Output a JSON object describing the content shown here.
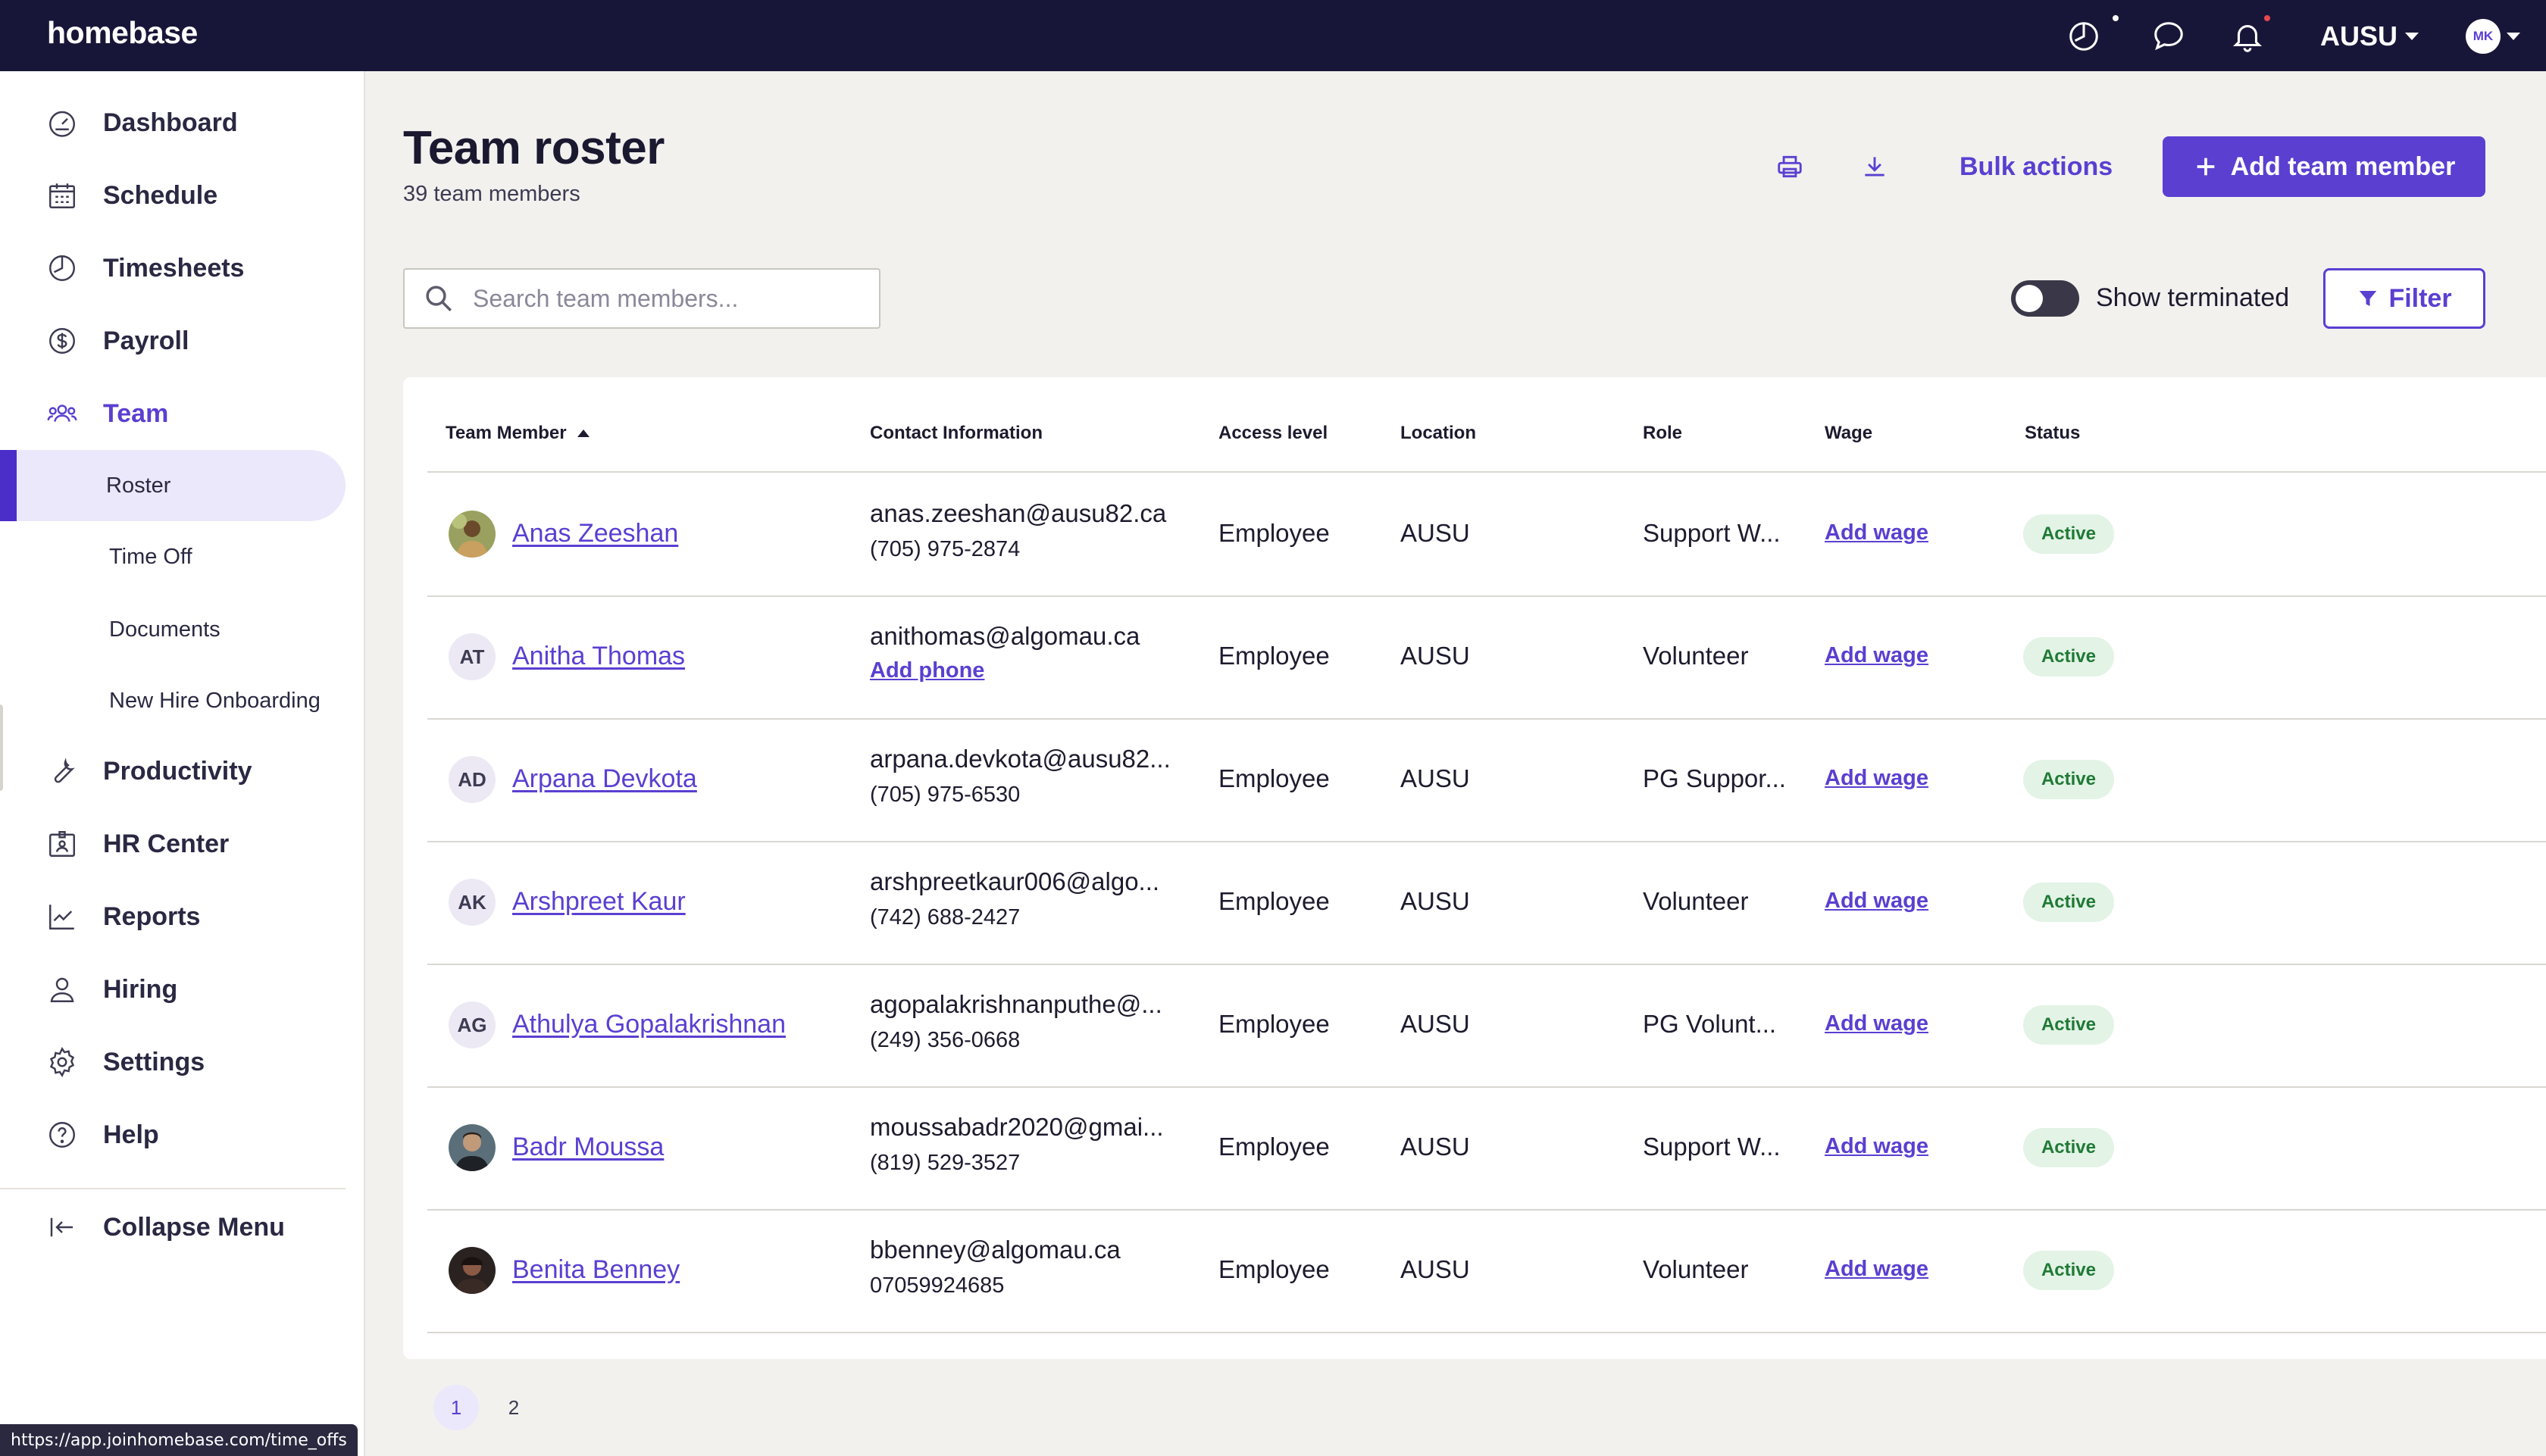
{
  "app": {
    "logo": "homebase",
    "company": "AUSU",
    "user_initials": "MK"
  },
  "sidebar": {
    "items": [
      {
        "label": "Dashboard",
        "icon": "dashboard-icon"
      },
      {
        "label": "Schedule",
        "icon": "calendar-icon"
      },
      {
        "label": "Timesheets",
        "icon": "clock-icon"
      },
      {
        "label": "Payroll",
        "icon": "dollar-icon"
      },
      {
        "label": "Team",
        "icon": "team-icon"
      }
    ],
    "team_subitems": [
      {
        "label": "Roster",
        "active": true
      },
      {
        "label": "Time Off",
        "active": false
      },
      {
        "label": "Documents",
        "active": false
      },
      {
        "label": "New Hire Onboarding",
        "active": false
      }
    ],
    "more_items": [
      {
        "label": "Productivity",
        "icon": "wrench-icon"
      },
      {
        "label": "HR Center",
        "icon": "badge-icon"
      },
      {
        "label": "Reports",
        "icon": "chart-icon"
      },
      {
        "label": "Hiring",
        "icon": "person-icon"
      },
      {
        "label": "Settings",
        "icon": "gear-icon"
      },
      {
        "label": "Help",
        "icon": "help-icon"
      }
    ],
    "collapse_label": "Collapse Menu"
  },
  "status_url": "https://app.joinhomebase.com/time_offs",
  "page": {
    "title": "Team roster",
    "subtitle": "39 team members",
    "bulk_actions": "Bulk actions",
    "add_member": "Add team member",
    "search_placeholder": "Search team members...",
    "show_terminated": "Show terminated",
    "filter": "Filter"
  },
  "table": {
    "columns": [
      "Team Member",
      "Contact Information",
      "Access level",
      "Location",
      "Role",
      "Wage",
      "Status"
    ],
    "rows": [
      {
        "initials": "",
        "avatar": "photo",
        "name": "Anas Zeeshan",
        "email": "anas.zeeshan@ausu82.ca",
        "phone": "(705) 975-2874",
        "phone_link": false,
        "access": "Employee",
        "location": "AUSU",
        "role": "Support W...",
        "wage": "Add wage",
        "status": "Active"
      },
      {
        "initials": "AT",
        "avatar": "initials",
        "name": "Anitha Thomas",
        "email": "anithomas@algomau.ca",
        "phone": "Add phone",
        "phone_link": true,
        "access": "Employee",
        "location": "AUSU",
        "role": "Volunteer",
        "wage": "Add wage",
        "status": "Active"
      },
      {
        "initials": "AD",
        "avatar": "initials",
        "name": "Arpana Devkota",
        "email": "arpana.devkota@ausu82...",
        "phone": "(705) 975-6530",
        "phone_link": false,
        "access": "Employee",
        "location": "AUSU",
        "role": "PG Suppor...",
        "wage": "Add wage",
        "status": "Active"
      },
      {
        "initials": "AK",
        "avatar": "initials",
        "name": "Arshpreet Kaur",
        "email": "arshpreetkaur006@algo...",
        "phone": "(742) 688-2427",
        "phone_link": false,
        "access": "Employee",
        "location": "AUSU",
        "role": "Volunteer",
        "wage": "Add wage",
        "status": "Active"
      },
      {
        "initials": "AG",
        "avatar": "initials",
        "name": "Athulya Gopalakrishnan",
        "email": "agopalakrishnanputhe@...",
        "phone": "(249) 356-0668",
        "phone_link": false,
        "access": "Employee",
        "location": "AUSU",
        "role": "PG Volunt...",
        "wage": "Add wage",
        "status": "Active"
      },
      {
        "initials": "",
        "avatar": "photo",
        "name": "Badr Moussa",
        "email": "moussabadr2020@gmai...",
        "phone": "(819) 529-3527",
        "phone_link": false,
        "access": "Employee",
        "location": "AUSU",
        "role": "Support W...",
        "wage": "Add wage",
        "status": "Active"
      },
      {
        "initials": "",
        "avatar": "photo",
        "name": "Benita Benney",
        "email": "bbenney@algomau.ca",
        "phone": "07059924685",
        "phone_link": false,
        "access": "Employee",
        "location": "AUSU",
        "role": "Volunteer",
        "wage": "Add wage",
        "status": "Active"
      }
    ]
  },
  "pagination": {
    "pages": [
      "1",
      "2"
    ],
    "current": "1"
  },
  "colors": {
    "accent": "#5b3fd1",
    "topbar": "#181638",
    "active_green": "#1f7a35"
  }
}
